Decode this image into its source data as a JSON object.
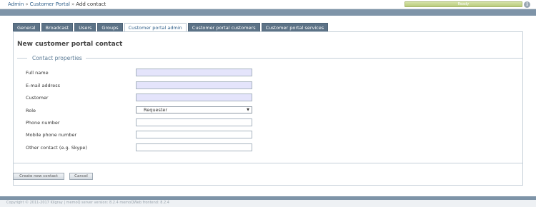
{
  "breadcrumb": {
    "items": [
      "Admin",
      "Customer Portal",
      "Add contact"
    ],
    "separator": "»"
  },
  "status": {
    "text": "Ready",
    "color": "#b9cb7c"
  },
  "info_icon": {
    "glyph": "i",
    "icon": "info-icon"
  },
  "tabs": [
    {
      "label": "General",
      "active": false
    },
    {
      "label": "Broadcast",
      "active": false
    },
    {
      "label": "Users",
      "active": false
    },
    {
      "label": "Groups",
      "active": false
    },
    {
      "label": "Customer portal admin",
      "active": true
    },
    {
      "label": "Customer portal customers",
      "active": false
    },
    {
      "label": "Customer portal services",
      "active": false
    }
  ],
  "form": {
    "title": "New customer portal contact",
    "section_legend": "Contact properties",
    "fields": [
      {
        "label": "Full name",
        "value": "",
        "required": true
      },
      {
        "label": "E-mail address",
        "value": "",
        "required": true
      },
      {
        "label": "Customer",
        "value": "",
        "required": true
      },
      {
        "label": "Role",
        "value": "Requester",
        "type": "select"
      },
      {
        "label": "Phone number",
        "value": "",
        "required": false
      },
      {
        "label": "Mobile phone number",
        "value": "",
        "required": false
      },
      {
        "label": "Other contact (e.g. Skype)",
        "value": "",
        "required": false
      }
    ],
    "buttons": {
      "create": "Create new contact",
      "cancel": "Cancel"
    }
  },
  "footer": {
    "text": "Copyright © 2011-2017 Kilgray | memoQ server version: 8.2.4 memoQWeb frontend: 8.2.4"
  },
  "colors": {
    "header_band": "#7e94a8",
    "tab_bg": "#5c7286",
    "required_field_bg": "#e4e4fb",
    "link": "#2f5f8a"
  }
}
